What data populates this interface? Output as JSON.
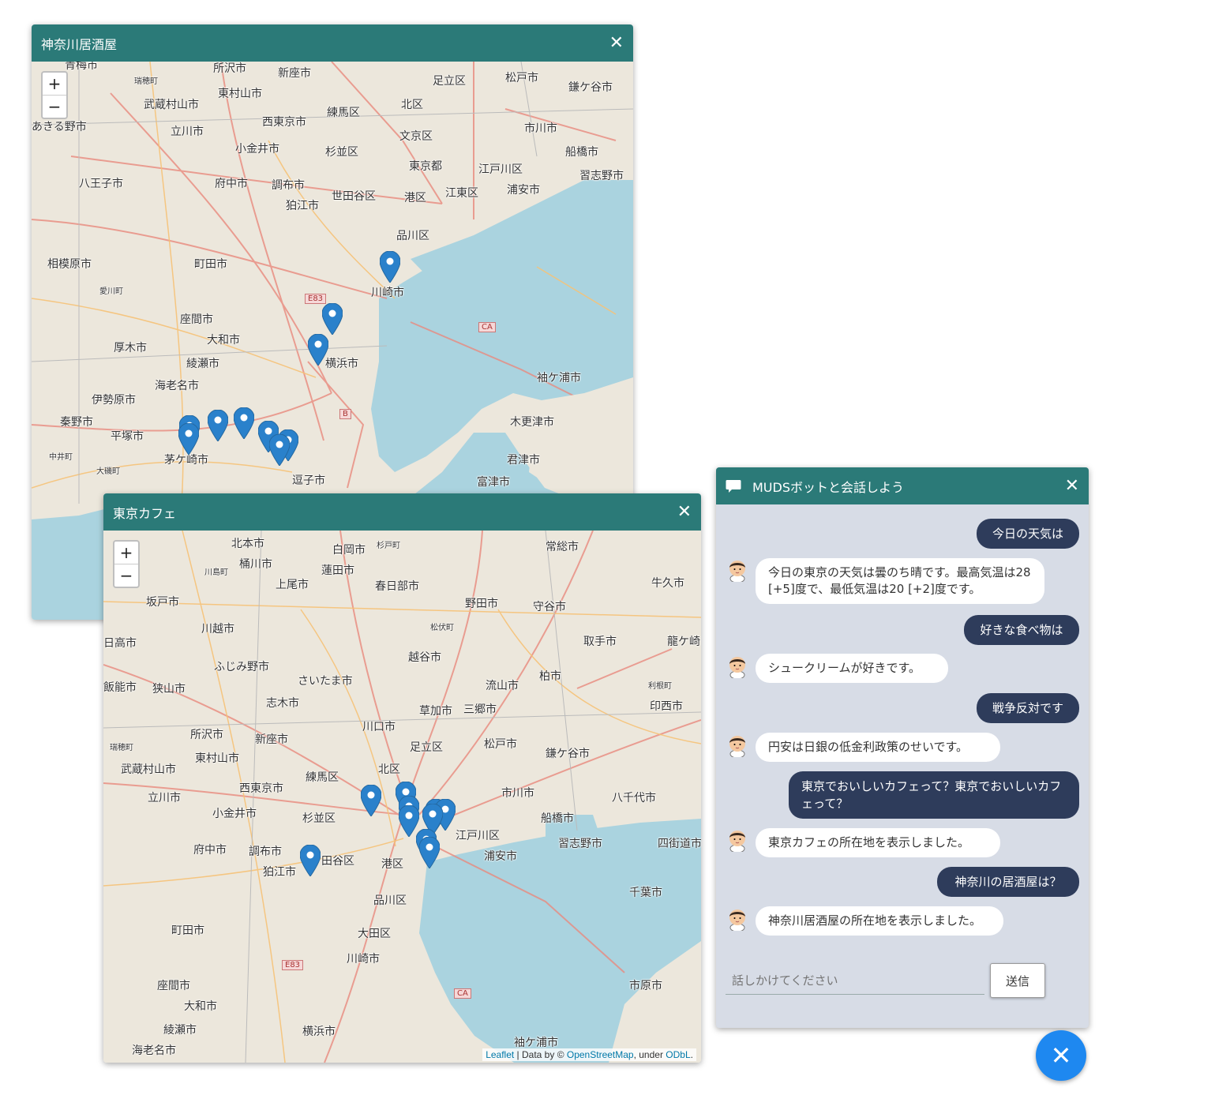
{
  "window1": {
    "title": "神奈川居酒屋",
    "close": "✕",
    "zoom_in": "+",
    "zoom_out": "−",
    "labels": [
      "青梅市",
      "所沢市",
      "新座市",
      "足立区",
      "松戸市",
      "鎌ケ谷市",
      "瑞穂町",
      "武蔵村山市",
      "東村山市",
      "北区",
      "練馬区",
      "あきる野市",
      "立川市",
      "西東京市",
      "文京区",
      "市川市",
      "小金井市",
      "杉並区",
      "船橋市",
      "東京都",
      "江戸川区",
      "習志野市",
      "八王子市",
      "府中市",
      "調布市",
      "世田谷区",
      "港区",
      "江東区",
      "浦安市",
      "狛江市",
      "品川区",
      "相模原市",
      "町田市",
      "川崎市",
      "座間市",
      "厚木市",
      "大和市",
      "綾瀬市",
      "横浜市",
      "袖ケ浦市",
      "海老名市",
      "伊勢原市",
      "木更津市",
      "秦野市",
      "平塚市",
      "茅ケ崎市",
      "逗子市",
      "君津市",
      "富津市",
      "中井町",
      "大磯町",
      "愛川町",
      "E83",
      "CA",
      "B"
    ]
  },
  "window2": {
    "title": "東京カフェ",
    "close": "✕",
    "zoom_in": "+",
    "zoom_out": "−",
    "labels": [
      "北本市",
      "白岡市",
      "杉戸町",
      "常総市",
      "桶川市",
      "川島町",
      "上尾市",
      "蓮田市",
      "春日部市",
      "牛久市",
      "坂戸市",
      "野田市",
      "守谷市",
      "川越市",
      "松伏町",
      "取手市",
      "龍ケ崎",
      "日高市",
      "越谷市",
      "ふじみ野市",
      "柏市",
      "さいたま市",
      "流山市",
      "利根町",
      "飯能市",
      "狭山市",
      "志木市",
      "印西市",
      "草加市",
      "三郷市",
      "川口市",
      "所沢市",
      "新座市",
      "足立区",
      "松戸市",
      "鎌ケ谷市",
      "瑞穂町",
      "東村山市",
      "武蔵村山市",
      "練馬区",
      "北区",
      "八千代市",
      "西東京市",
      "立川市",
      "市川市",
      "小金井市",
      "杉並区",
      "船橋市",
      "江戸川区",
      "府中市",
      "調布市",
      "習志野市",
      "四街道市",
      "狛江市",
      "田谷区",
      "港区",
      "浦安市",
      "千葉市",
      "品川区",
      "大田区",
      "町田市",
      "川崎市",
      "E83",
      "CA",
      "座間市",
      "市原市",
      "大和市",
      "横浜市",
      "綾瀬市",
      "袖ケ浦市",
      "海老名市"
    ],
    "attribution": {
      "leaflet": "Leaflet",
      "sep": " | Data by © ",
      "osm": "OpenStreetMap",
      "under": ", under ",
      "odbl": "ODbL",
      "end": "."
    }
  },
  "chat": {
    "title": "MUDSボットと会話しよう",
    "close": "✕",
    "messages": [
      {
        "from": "user",
        "text": "今日の天気は"
      },
      {
        "from": "bot",
        "text": "今日の東京の天気は曇のち晴です。最高気温は28 [+5]度で、最低気温は20 [+2]度です。"
      },
      {
        "from": "user",
        "text": "好きな食べ物は"
      },
      {
        "from": "bot",
        "text": "シュークリームが好きです。"
      },
      {
        "from": "user",
        "text": "戦争反対です"
      },
      {
        "from": "bot",
        "text": "円安は日銀の低金利政策のせいです。"
      },
      {
        "from": "user",
        "text": "東京でおいしいカフェって？東京でおいしいカフェって？"
      },
      {
        "from": "bot",
        "text": "東京カフェの所在地を表示しました。"
      },
      {
        "from": "user",
        "text": "神奈川の居酒屋は？"
      },
      {
        "from": "bot",
        "text": "神奈川居酒屋の所在地を表示しました。"
      }
    ],
    "input_placeholder": "話しかけてください",
    "input_value": "",
    "send_label": "送信"
  },
  "fab_icon": "✕",
  "colors": {
    "header": "#2b7a78",
    "user_bubble": "#2e3c5b",
    "chat_bg": "#d7dce6",
    "fab": "#1e88f0",
    "sea": "#aad3df",
    "marker": "#2a81cb"
  },
  "icons": {
    "chat_header": "chat-bubble-icon",
    "marker": "map-marker-icon",
    "bot_avatar": "bot-avatar-icon"
  }
}
